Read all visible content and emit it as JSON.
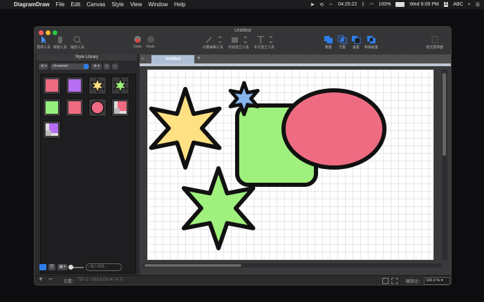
{
  "menubar": {
    "app_name": "DiagramDraw",
    "items": [
      "File",
      "Edit",
      "Canvas",
      "Style",
      "View",
      "Window",
      "Help"
    ],
    "clock_time": "04:25:22",
    "battery": "100%",
    "datetime": "Wed 6:09 PM",
    "input_source": "ABC"
  },
  "window": {
    "title": "Untitled",
    "traffic_colors": [
      "#fe5f57",
      "#febc2e",
      "#28c840"
    ]
  },
  "toolbar": {
    "select_tool": "選擇工具",
    "move_tool": "移動工具",
    "zoom_tool": "縮放工具",
    "undo": "Undo",
    "redo": "Redo",
    "vector_edit": "向量編輯工具",
    "shape_tool": "形狀建立工具",
    "text_tool": "本文建立工具",
    "union": "聯集",
    "intersect": "交集",
    "difference": "差集",
    "exclusive": "對稱差集",
    "style_picker": "樣式選擇器"
  },
  "style_library": {
    "title": "Style Library",
    "preset": "Unnamed",
    "search_placeholder": "輸入搜尋..."
  },
  "swatches": [
    {
      "shape": "rect",
      "color": "#ee6b82"
    },
    {
      "shape": "rect",
      "color": "#b76ef3"
    },
    {
      "shape": "star",
      "color": "#ffe083"
    },
    {
      "shape": "star",
      "color": "#9ff07c"
    },
    {
      "shape": "rect",
      "color": "#96f07d"
    },
    {
      "shape": "rect",
      "color": "#ee6b82"
    },
    {
      "shape": "circle",
      "color": "#ee6b82"
    },
    {
      "shape": "composite",
      "color": "#ee6b82"
    },
    {
      "shape": "composite",
      "color": "#b76ef3"
    }
  ],
  "document_tab": "Untitled",
  "canvas_colors": {
    "yellow_star": "#ffe083",
    "blue_star": "#88b4f0",
    "green": "#9ff07c",
    "pink": "#ee6b82",
    "outline": "#111111"
  },
  "status": {
    "position_label": "位置：",
    "position_value": "737.1 / 333.9 (10.4 / 4.7)",
    "zoom_label": "縮放比：",
    "zoom_value": "100.0 %"
  }
}
